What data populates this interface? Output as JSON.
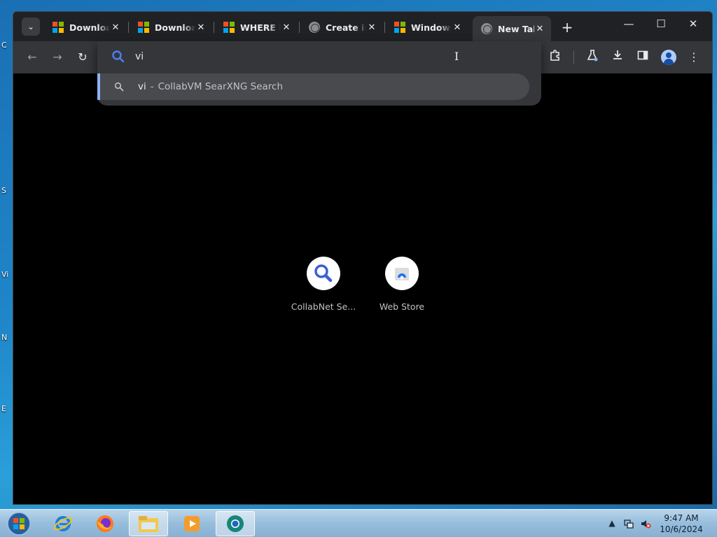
{
  "desktop": {
    "peek_labels": [
      "C",
      "S",
      "Vi",
      "N",
      "E"
    ]
  },
  "tabs": [
    {
      "title": "Download",
      "icon": "microsoft-logo"
    },
    {
      "title": "Download",
      "icon": "microsoft-logo"
    },
    {
      "title": "WHERE is",
      "icon": "microsoft-logo"
    },
    {
      "title": "Create in",
      "icon": "globe-icon"
    },
    {
      "title": "Windows",
      "icon": "microsoft-logo"
    },
    {
      "title": "New Tab",
      "icon": "globe-icon",
      "active": true
    }
  ],
  "tab_close_glyph": "✕",
  "omnibox": {
    "value": "vi",
    "suggestion_query": "vi",
    "suggestion_separator": "-",
    "suggestion_engine": "CollabVM SearXNG Search"
  },
  "shortcuts": [
    {
      "label": "CollabNet Se...",
      "icon": "magnifier-icon"
    },
    {
      "label": "Web Store",
      "icon": "webstore-icon"
    }
  ],
  "clock": {
    "time": "9:47 AM",
    "date": "10/6/2024"
  },
  "colors": {
    "accent": "#8ab4f8",
    "search_icon_blue": "#4c7ff0",
    "tab_bar": "#202124",
    "toolbar": "#35363a"
  }
}
